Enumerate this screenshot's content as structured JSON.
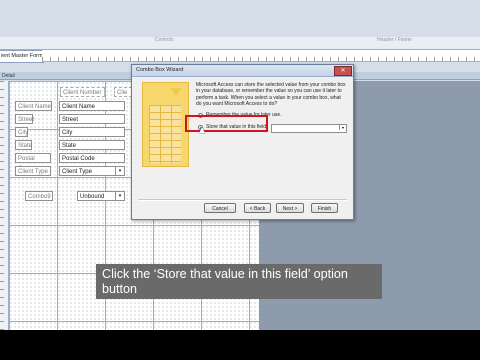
{
  "app": {
    "tab_fragment_center": "Controls",
    "tab_fragment_right": "Header / Footer",
    "document_tab": "ient Master Form",
    "section_label": "Detail"
  },
  "form": {
    "labels": [
      "Client Number",
      "Client Name",
      "Street",
      "City",
      "State",
      "Postal Code",
      "Client Type",
      "Combo9"
    ],
    "fields": [
      "Client Name",
      "Street",
      "City",
      "State",
      "Postal Code",
      "Client Type",
      "Unbound"
    ],
    "client_label_header": "Client Number",
    "client_header_right": "Clie"
  },
  "dialog": {
    "title": "Combo Box Wizard",
    "description": "Microsoft Access can store the selected value from your combo box in your database, or remember the value so you can use it later to perform a task. When you select a value in your combo box, what do you want Microsoft Access to do?",
    "option_remember": "Remember the value for later use.",
    "option_store": "Store that value in this field:",
    "buttons": {
      "cancel": "Cancel",
      "back": "< Back",
      "next": "Next >",
      "finish": "Finish"
    }
  },
  "caption": "Click the ‘Store that value in this field’ option button",
  "colors": {
    "highlight": "#d4141c",
    "illustration": "#f7d66b"
  }
}
